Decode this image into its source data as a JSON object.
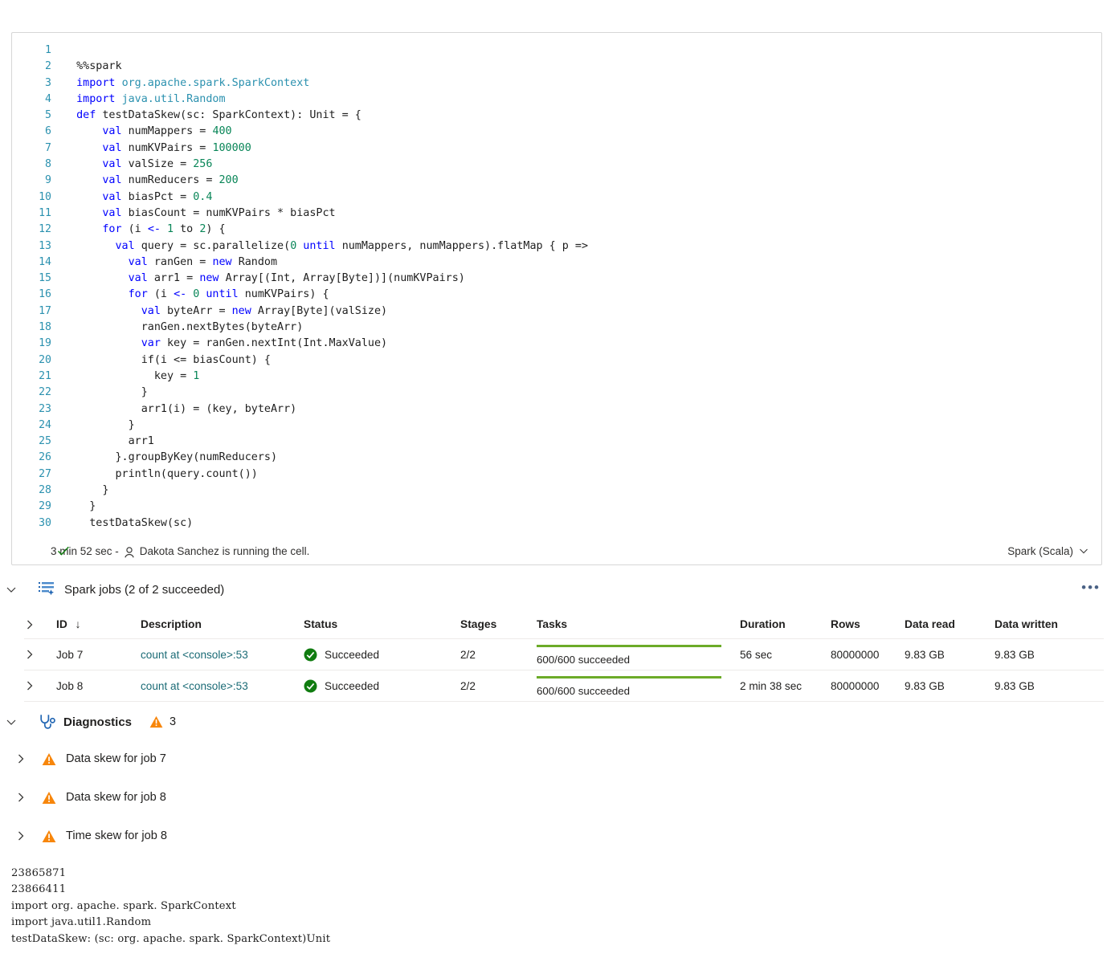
{
  "cell": {
    "language_label": "Spark (Scala)",
    "status_duration": "3 min 52 sec -",
    "status_user": "Dakota Sanchez is running the cell.",
    "code_lines": [
      {
        "n": "1",
        "tokens": []
      },
      {
        "n": "2",
        "tokens": [
          {
            "t": "mag",
            "s": "  %%spark"
          }
        ]
      },
      {
        "n": "3",
        "tokens": [
          {
            "t": "kw",
            "s": "  import "
          },
          {
            "t": "ns",
            "s": "org.apache.spark.SparkContext"
          }
        ]
      },
      {
        "n": "4",
        "tokens": [
          {
            "t": "kw",
            "s": "  import "
          },
          {
            "t": "ns",
            "s": "java.util.Random"
          }
        ]
      },
      {
        "n": "5",
        "tokens": [
          {
            "t": "kw",
            "s": "  def "
          },
          {
            "t": "plain",
            "s": "testDataSkew(sc: SparkContext): Unit = {"
          }
        ]
      },
      {
        "n": "6",
        "tokens": [
          {
            "t": "kw",
            "s": "      val "
          },
          {
            "t": "plain",
            "s": "numMappers = "
          },
          {
            "t": "num",
            "s": "400"
          }
        ]
      },
      {
        "n": "7",
        "tokens": [
          {
            "t": "kw",
            "s": "      val "
          },
          {
            "t": "plain",
            "s": "numKVPairs = "
          },
          {
            "t": "num",
            "s": "100000"
          }
        ]
      },
      {
        "n": "8",
        "tokens": [
          {
            "t": "kw",
            "s": "      val "
          },
          {
            "t": "plain",
            "s": "valSize = "
          },
          {
            "t": "num",
            "s": "256"
          }
        ]
      },
      {
        "n": "9",
        "tokens": [
          {
            "t": "kw",
            "s": "      val "
          },
          {
            "t": "plain",
            "s": "numReducers = "
          },
          {
            "t": "num",
            "s": "200"
          }
        ]
      },
      {
        "n": "10",
        "tokens": [
          {
            "t": "kw",
            "s": "      val "
          },
          {
            "t": "plain",
            "s": "biasPct = "
          },
          {
            "t": "num",
            "s": "0.4"
          }
        ]
      },
      {
        "n": "11",
        "tokens": [
          {
            "t": "kw",
            "s": "      val "
          },
          {
            "t": "plain",
            "s": "biasCount = numKVPairs * biasPct"
          }
        ]
      },
      {
        "n": "12",
        "tokens": [
          {
            "t": "kw",
            "s": "      for "
          },
          {
            "t": "plain",
            "s": "(i "
          },
          {
            "t": "kw",
            "s": "<- "
          },
          {
            "t": "num",
            "s": "1"
          },
          {
            "t": "plain",
            "s": " to "
          },
          {
            "t": "num",
            "s": "2"
          },
          {
            "t": "plain",
            "s": ") {"
          }
        ]
      },
      {
        "n": "13",
        "tokens": [
          {
            "t": "kw",
            "s": "        val "
          },
          {
            "t": "plain",
            "s": "query = sc.parallelize("
          },
          {
            "t": "num",
            "s": "0"
          },
          {
            "t": "kw",
            "s": " until "
          },
          {
            "t": "plain",
            "s": "numMappers, numMappers).flatMap { p =>"
          }
        ]
      },
      {
        "n": "14",
        "tokens": [
          {
            "t": "kw",
            "s": "          val "
          },
          {
            "t": "plain",
            "s": "ranGen = "
          },
          {
            "t": "kw",
            "s": "new "
          },
          {
            "t": "plain",
            "s": "Random"
          }
        ]
      },
      {
        "n": "15",
        "tokens": [
          {
            "t": "kw",
            "s": "          val "
          },
          {
            "t": "plain",
            "s": "arr1 = "
          },
          {
            "t": "kw",
            "s": "new "
          },
          {
            "t": "plain",
            "s": "Array[(Int, Array[Byte])](numKVPairs)"
          }
        ]
      },
      {
        "n": "16",
        "tokens": [
          {
            "t": "kw",
            "s": "          for "
          },
          {
            "t": "plain",
            "s": "(i "
          },
          {
            "t": "kw",
            "s": "<- "
          },
          {
            "t": "num",
            "s": "0"
          },
          {
            "t": "kw",
            "s": " until "
          },
          {
            "t": "plain",
            "s": "numKVPairs) {"
          }
        ]
      },
      {
        "n": "17",
        "tokens": [
          {
            "t": "kw",
            "s": "            val "
          },
          {
            "t": "plain",
            "s": "byteArr = "
          },
          {
            "t": "kw",
            "s": "new "
          },
          {
            "t": "plain",
            "s": "Array[Byte](valSize)"
          }
        ]
      },
      {
        "n": "18",
        "tokens": [
          {
            "t": "plain",
            "s": "            ranGen.nextBytes(byteArr)"
          }
        ]
      },
      {
        "n": "19",
        "tokens": [
          {
            "t": "kw",
            "s": "            var "
          },
          {
            "t": "plain",
            "s": "key = ranGen.nextInt(Int.MaxValue)"
          }
        ]
      },
      {
        "n": "20",
        "tokens": [
          {
            "t": "plain",
            "s": "            if(i <= biasCount) {"
          }
        ]
      },
      {
        "n": "21",
        "tokens": [
          {
            "t": "plain",
            "s": "              key = "
          },
          {
            "t": "num",
            "s": "1"
          }
        ]
      },
      {
        "n": "22",
        "tokens": [
          {
            "t": "plain",
            "s": "            }"
          }
        ]
      },
      {
        "n": "23",
        "tokens": [
          {
            "t": "plain",
            "s": "            arr1(i) = (key, byteArr)"
          }
        ]
      },
      {
        "n": "24",
        "tokens": [
          {
            "t": "plain",
            "s": "          }"
          }
        ]
      },
      {
        "n": "25",
        "tokens": [
          {
            "t": "plain",
            "s": "          arr1"
          }
        ]
      },
      {
        "n": "26",
        "tokens": [
          {
            "t": "plain",
            "s": "        }.groupByKey(numReducers)"
          }
        ]
      },
      {
        "n": "27",
        "tokens": [
          {
            "t": "plain",
            "s": "        println(query.count())"
          }
        ]
      },
      {
        "n": "28",
        "tokens": [
          {
            "t": "plain",
            "s": "      }"
          }
        ]
      },
      {
        "n": "29",
        "tokens": [
          {
            "t": "plain",
            "s": "    }"
          }
        ]
      },
      {
        "n": "30",
        "tokens": [
          {
            "t": "plain",
            "s": "    testDataSkew(sc)"
          }
        ]
      }
    ]
  },
  "spark_jobs": {
    "title": "Spark jobs (2 of 2 succeeded)",
    "more_label": "•••",
    "columns": {
      "id": "ID",
      "description": "Description",
      "status": "Status",
      "stages": "Stages",
      "tasks": "Tasks",
      "duration": "Duration",
      "rows": "Rows",
      "data_read": "Data read",
      "data_written": "Data written"
    },
    "sort_arrow": "↓",
    "rows": [
      {
        "id": "Job 7",
        "description": "count at <console>:53",
        "status": "Succeeded",
        "stages": "2/2",
        "tasks": "600/600 succeeded",
        "tasks_pct": 100,
        "duration": "56 sec",
        "rows": "80000000",
        "data_read": "9.83 GB",
        "data_written": "9.83 GB"
      },
      {
        "id": "Job 8",
        "description": "count at <console>:53",
        "status": "Succeeded",
        "stages": "2/2",
        "tasks": "600/600 succeeded",
        "tasks_pct": 100,
        "duration": "2 min 38 sec",
        "rows": "80000000",
        "data_read": "9.83 GB",
        "data_written": "9.83 GB"
      }
    ]
  },
  "diagnostics": {
    "title": "Diagnostics",
    "warning_count": "3",
    "items": [
      {
        "label": "Data skew for job 7"
      },
      {
        "label": "Data skew for job 8"
      },
      {
        "label": "Time skew for job 8"
      }
    ]
  },
  "console_output": "23865871\n23866411\nimport org. apache. spark. SparkContext\nimport java.util1.Random\ntestDataSkew: (sc: org. apache. spark. SparkContext)Unit",
  "colors": {
    "success_green": "#107c10",
    "progress_green": "#6cab28",
    "warning_orange": "#f7860b",
    "link_teal": "#1b6b76",
    "accent_blue": "#2266b3",
    "keyword_blue": "#0000ff",
    "namespace_teal": "#2b91af",
    "number_green": "#098658"
  }
}
